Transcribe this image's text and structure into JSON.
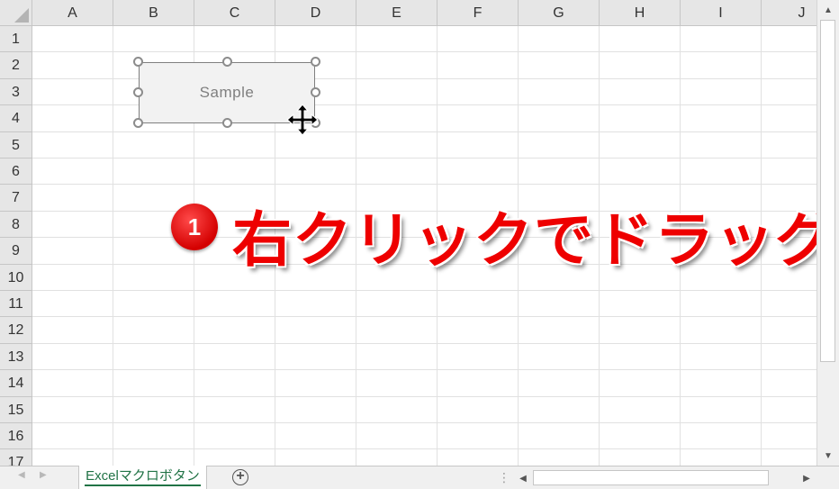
{
  "columns": [
    "A",
    "B",
    "C",
    "D",
    "E",
    "F",
    "G",
    "H",
    "I",
    "J"
  ],
  "rows": [
    "1",
    "2",
    "3",
    "4",
    "5",
    "6",
    "7",
    "8",
    "9",
    "10",
    "11",
    "12",
    "13",
    "14",
    "15",
    "16",
    "17"
  ],
  "shape": {
    "label": "Sample"
  },
  "annotation": {
    "step_number": "1",
    "text": "右クリックでドラッグ",
    "color": "#ee0000"
  },
  "sheet_tabs": [
    {
      "label": "Excelマクロボタン",
      "active": true
    }
  ],
  "colors": {
    "tab_text": "#217346",
    "header_bg": "#e6e6e6",
    "gridline": "#e1e1e1"
  },
  "icons": {
    "move_cursor": "move-arrows-icon",
    "add_sheet": "plus-circle-icon",
    "scroll_up": "triangle-up-icon",
    "scroll_down": "triangle-down-icon",
    "scroll_left": "triangle-left-icon",
    "scroll_right": "triangle-right-icon"
  }
}
